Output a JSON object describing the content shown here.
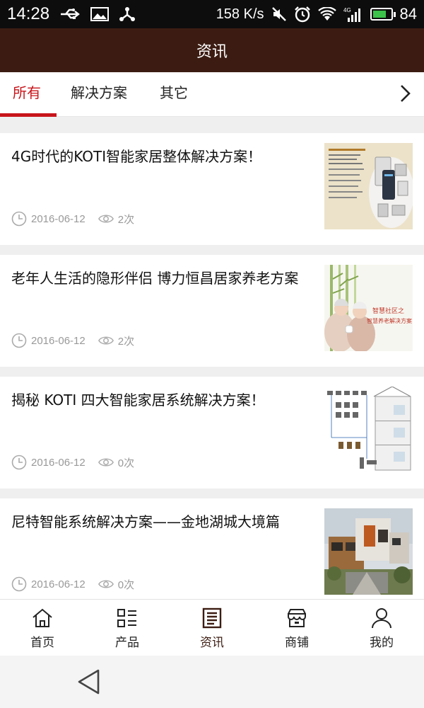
{
  "status_bar": {
    "time": "14:28",
    "net_speed": "158 K/s",
    "battery_level": "84",
    "battery_fraction": 0.84,
    "left_icons": [
      "usb-icon",
      "image-icon",
      "share-network-icon"
    ],
    "right_icons": [
      "mute-icon",
      "alarm-icon",
      "wifi-icon",
      "signal-4g-icon",
      "battery-icon"
    ]
  },
  "header": {
    "title": "资讯"
  },
  "tabs": [
    {
      "label": "所有",
      "active": true
    },
    {
      "label": "解决方案",
      "active": false
    },
    {
      "label": "其它",
      "active": false
    }
  ],
  "articles": [
    {
      "title": "4G时代的KOTI智能家居整体解决方案！",
      "date": "2016-06-12",
      "views": "2次"
    },
    {
      "title": "老年人生活的隐形伴侣 博力恒昌居家养老方案",
      "date": "2016-06-12",
      "views": "2次",
      "thumb_caption_1": "智慧社区之",
      "thumb_caption_2": "智慧养老解决方案"
    },
    {
      "title": "揭秘 KOTI 四大智能家居系统解决方案！",
      "date": "2016-06-12",
      "views": "0次"
    },
    {
      "title": "尼特智能系统解决方案——金地湖城大境篇",
      "date": "2016-06-12",
      "views": "0次"
    }
  ],
  "bottom_nav": [
    {
      "label": "首页",
      "icon": "home-icon"
    },
    {
      "label": "产品",
      "icon": "product-list-icon"
    },
    {
      "label": "资讯",
      "icon": "news-icon",
      "active": true
    },
    {
      "label": "商铺",
      "icon": "store-icon"
    },
    {
      "label": "我的",
      "icon": "user-icon"
    }
  ],
  "colors": {
    "header_bg": "#3c1c12",
    "accent": "#c8151b"
  }
}
